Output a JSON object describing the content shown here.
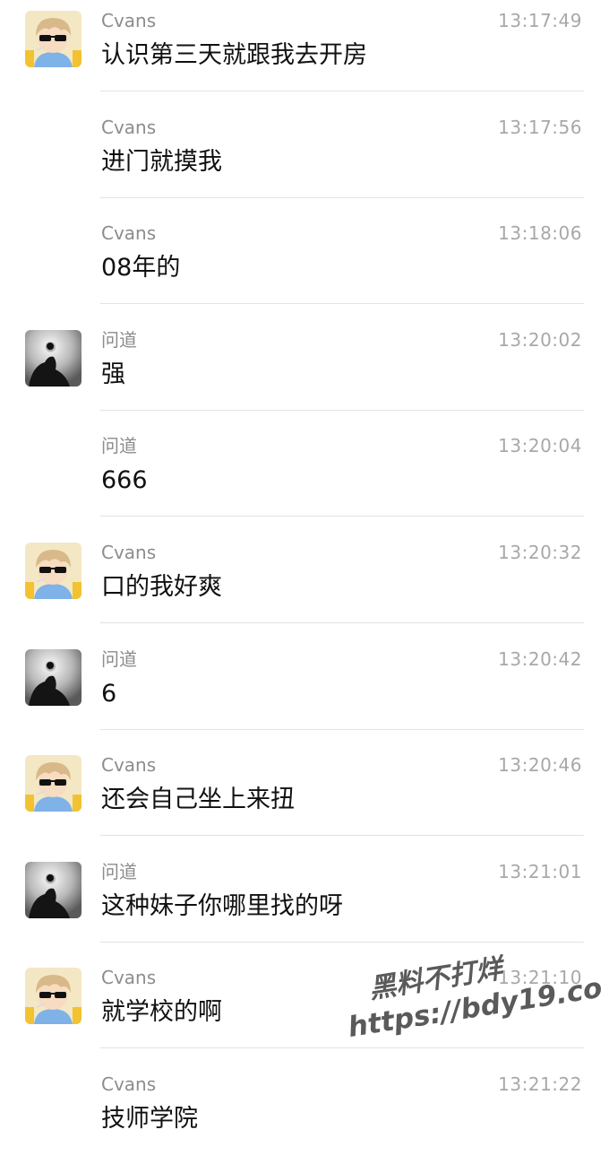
{
  "messages": [
    {
      "sender": "Cvans",
      "avatar": "cartoon-boy",
      "time": "13:17:49",
      "text": "认识第三天就跟我去开房"
    },
    {
      "sender": "Cvans",
      "avatar": "",
      "time": "13:17:56",
      "text": "进门就摸我"
    },
    {
      "sender": "Cvans",
      "avatar": "",
      "time": "13:18:06",
      "text": "08年的"
    },
    {
      "sender": "问道",
      "avatar": "dark-photo",
      "time": "13:20:02",
      "text": "强"
    },
    {
      "sender": "问道",
      "avatar": "",
      "time": "13:20:04",
      "text": "666"
    },
    {
      "sender": "Cvans",
      "avatar": "cartoon-boy",
      "time": "13:20:32",
      "text": "口的我好爽"
    },
    {
      "sender": "问道",
      "avatar": "dark-photo",
      "time": "13:20:42",
      "text": "6"
    },
    {
      "sender": "Cvans",
      "avatar": "cartoon-boy",
      "time": "13:20:46",
      "text": "还会自己坐上来扭"
    },
    {
      "sender": "问道",
      "avatar": "dark-photo",
      "time": "13:21:01",
      "text": "这种妹子你哪里找的呀"
    },
    {
      "sender": "Cvans",
      "avatar": "cartoon-boy",
      "time": "13:21:10",
      "text": "就学校的啊"
    },
    {
      "sender": "Cvans",
      "avatar": "",
      "time": "13:21:22",
      "text": "技师学院"
    }
  ],
  "watermark": {
    "line1": "黑料不打烊",
    "line2": "https://bdy19.co"
  },
  "colors": {
    "name": "#8c8c8c",
    "time": "#a8a8a8",
    "text": "#111111",
    "separator": "#e3e3e3"
  }
}
